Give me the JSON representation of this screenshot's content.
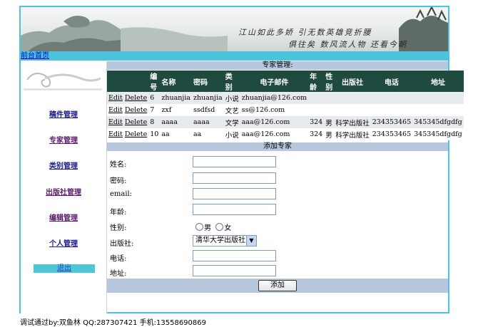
{
  "banner": {
    "poem_line1": "江山如此多娇 引无数英雄竞折腰",
    "poem_line2": "俱往矣 数风流人物 还看今朝"
  },
  "nav": {
    "home_link": "前台首页"
  },
  "sidebar": {
    "items": [
      {
        "label": "稿件管理"
      },
      {
        "label": "专家管理"
      },
      {
        "label": "类别管理"
      },
      {
        "label": "出版社管理"
      },
      {
        "label": "编辑管理"
      },
      {
        "label": "个人管理"
      }
    ],
    "logout": "退出"
  },
  "list_section": {
    "title": "专家管理:",
    "columns": [
      "编号",
      "名称",
      "密码",
      "类别",
      "电子邮件",
      "年龄",
      "性别",
      "出版社",
      "电话",
      "地址"
    ],
    "edit_label": "Edit",
    "delete_label": "Delete",
    "rows": [
      {
        "id": "6",
        "name": "zhuanjia",
        "password": "zhuanjia",
        "category": "小说",
        "email": "zhuanjia@126.com",
        "age": "",
        "gender": "",
        "publisher": "",
        "phone": "",
        "address": ""
      },
      {
        "id": "7",
        "name": "zxf",
        "password": "ssdfsd",
        "category": "文艺",
        "email": "ss@126.com",
        "age": "",
        "gender": "",
        "publisher": "",
        "phone": "",
        "address": ""
      },
      {
        "id": "8",
        "name": "aaaa",
        "password": "aaaa",
        "category": "文学",
        "email": "aaa@126.com",
        "age": "324",
        "gender": "男",
        "publisher": "科学出版社",
        "phone": "234353465",
        "address": "345345dfgdfg"
      },
      {
        "id": "10",
        "name": "aa",
        "password": "aa",
        "category": "小说",
        "email": "aaa@126.com",
        "age": "324",
        "gender": "男",
        "publisher": "科学出版社",
        "phone": "234353465",
        "address": "345345dfgdfg"
      }
    ]
  },
  "form": {
    "title": "添加专家",
    "name_label": "姓名:",
    "password_label": "密码:",
    "email_label": "email:",
    "age_label": "年龄:",
    "gender_label": "性别:",
    "gender_male": "男",
    "gender_female": "女",
    "publisher_label": "出版社:",
    "publisher_selected": "清华大学出版社",
    "phone_label": "电话:",
    "address_label": "地址:",
    "submit_label": "添加"
  },
  "footer": {
    "text": "调试通过by:双鱼林 QQ:287307421 手机:13558690869"
  }
}
